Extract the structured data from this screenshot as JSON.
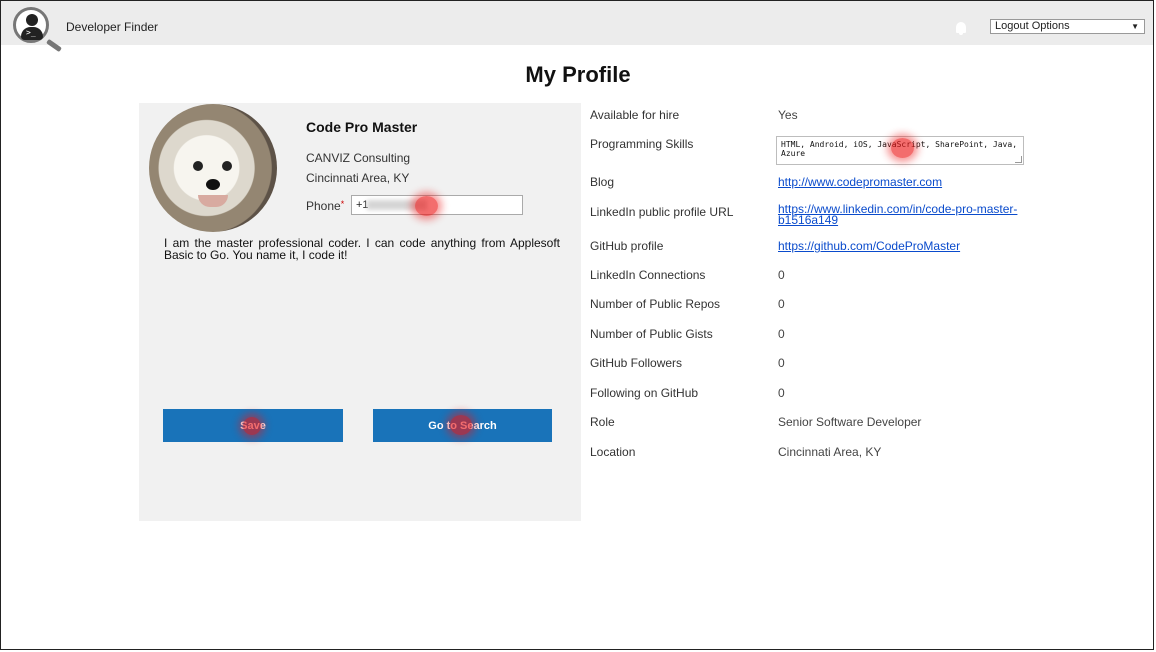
{
  "app": {
    "title": "Developer Finder",
    "logout_label": "Logout Options"
  },
  "page": {
    "title": "My Profile"
  },
  "profile": {
    "name": "Code Pro Master",
    "company": "CANVIZ Consulting",
    "location": "Cincinnati Area, KY",
    "phone_label": "Phone",
    "phone_value": "+1",
    "bio": "I am the master professional coder. I can code anything from Applesoft Basic to Go. You name it, I code it!",
    "buttons": {
      "save": "Save",
      "search": "Go to Search"
    }
  },
  "details": {
    "available": {
      "label": "Available for hire",
      "value": "Yes"
    },
    "skills": {
      "label": "Programming Skills",
      "value": "HTML, Android, iOS, JavaScript, SharePoint, Java, Azure"
    },
    "blog": {
      "label": "Blog",
      "value": "http://www.codepromaster.com"
    },
    "linkedin": {
      "label": "LinkedIn public profile URL",
      "value_line1": "https://www.linkedin.com/in/code-pro-master-",
      "value_line2": "b1516a149"
    },
    "github": {
      "label": "GitHub profile",
      "value": "https://github.com/CodeProMaster"
    },
    "connections": {
      "label": "LinkedIn Connections",
      "value": "0"
    },
    "repos": {
      "label": "Number of Public Repos",
      "value": "0"
    },
    "gists": {
      "label": "Number of Public Gists",
      "value": "0"
    },
    "followers": {
      "label": "GitHub Followers",
      "value": "0"
    },
    "following": {
      "label": "Following on GitHub",
      "value": "0"
    },
    "role": {
      "label": "Role",
      "value": "Senior Software Developer"
    },
    "location": {
      "label": "Location",
      "value": "Cincinnati Area, KY"
    }
  },
  "icons": {
    "logo": "developer-finder-logo-icon",
    "notification": "bell-icon"
  },
  "colors": {
    "button": "#1973b9",
    "link": "#0a4bcc",
    "topbar": "#ececec"
  }
}
